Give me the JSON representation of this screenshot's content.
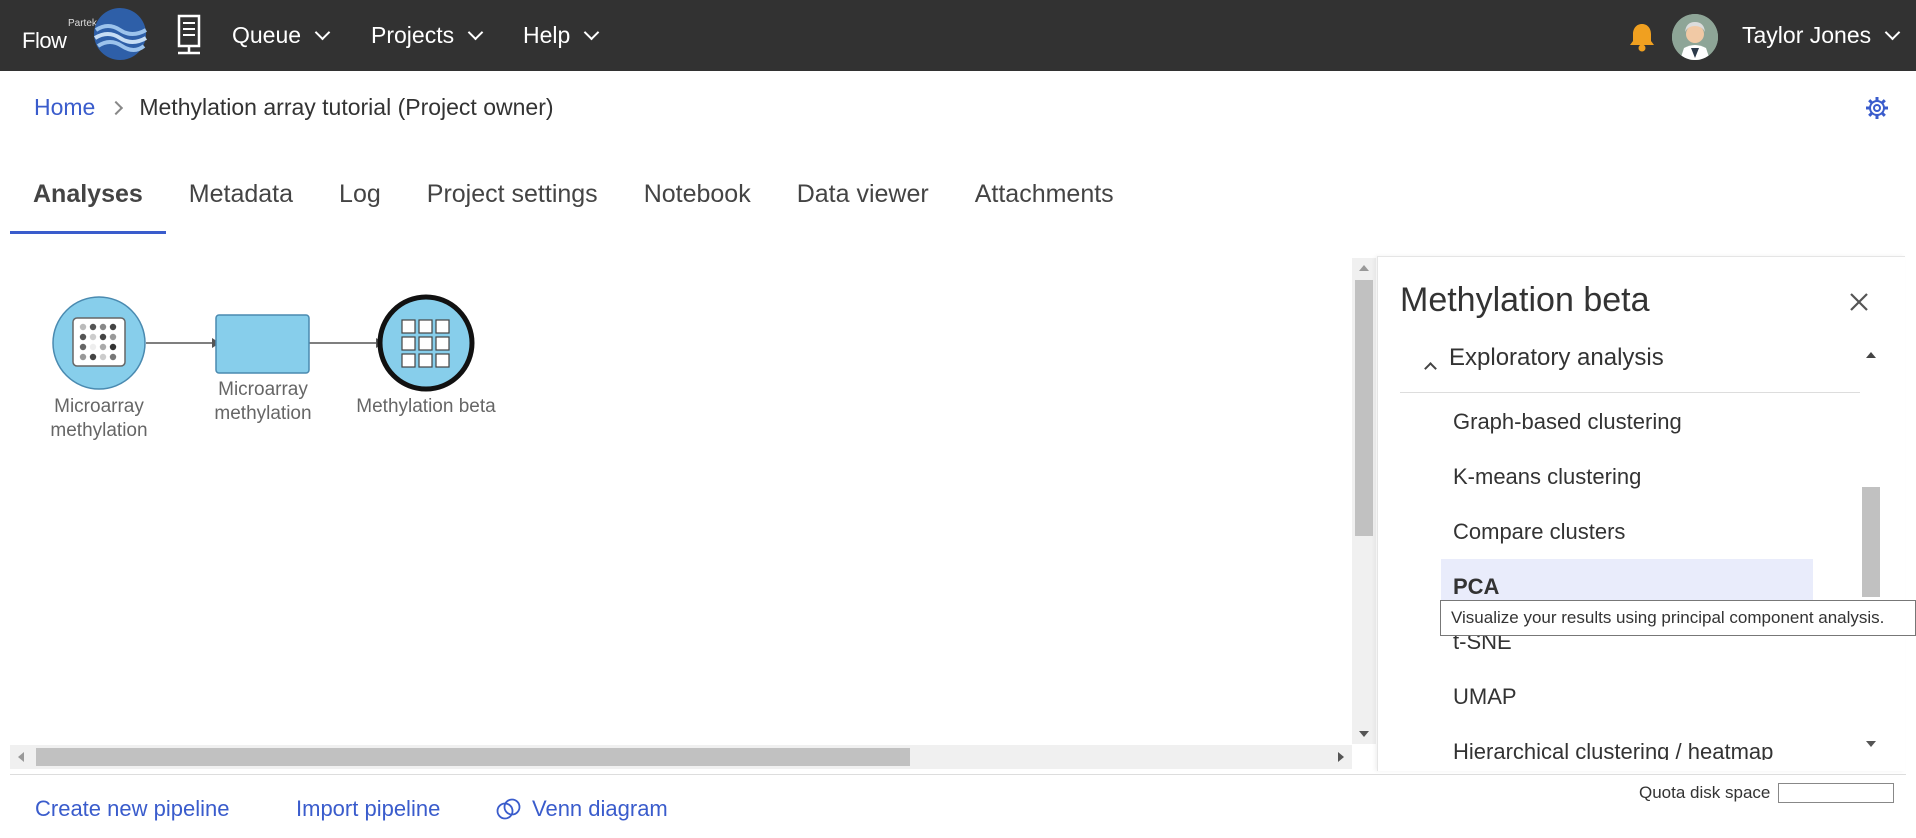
{
  "app": {
    "brand_small": "Partek",
    "brand_name": "Flow"
  },
  "nav": {
    "items": [
      {
        "label": "Queue"
      },
      {
        "label": "Projects"
      },
      {
        "label": "Help"
      }
    ],
    "user_name": "Taylor Jones"
  },
  "breadcrumb": {
    "home": "Home",
    "current": "Methylation array tutorial (Project owner)"
  },
  "tabs": [
    {
      "label": "Analyses",
      "active": true
    },
    {
      "label": "Metadata"
    },
    {
      "label": "Log"
    },
    {
      "label": "Project settings"
    },
    {
      "label": "Notebook"
    },
    {
      "label": "Data viewer"
    },
    {
      "label": "Attachments"
    }
  ],
  "pipeline": {
    "nodes": [
      {
        "label_line1": "Microarray",
        "label_line2": "methylation",
        "kind": "data-circle"
      },
      {
        "label_line1": "Microarray",
        "label_line2": "methylation",
        "kind": "task-rect"
      },
      {
        "label_line1": "Methylation beta",
        "label_line2": "",
        "kind": "data-circle-selected"
      }
    ]
  },
  "panel": {
    "title": "Methylation beta",
    "section": "Exploratory analysis",
    "items": [
      {
        "label": "Graph-based clustering"
      },
      {
        "label": "K-means clustering"
      },
      {
        "label": "Compare clusters"
      },
      {
        "label": "PCA",
        "highlighted": true
      },
      {
        "label": "t-SNE"
      },
      {
        "label": "UMAP"
      },
      {
        "label": "Hierarchical clustering / heatmap"
      }
    ],
    "tooltip": "Visualize your results using principal component analysis."
  },
  "footer": {
    "create_pipeline": "Create new pipeline",
    "import_pipeline": "Import pipeline",
    "venn_diagram": "Venn diagram",
    "quota_label": "Quota disk space"
  },
  "colors": {
    "topbar": "#323232",
    "link": "#3a5ccc",
    "node_fill": "#87ceeb",
    "bell": "#f0a020"
  }
}
